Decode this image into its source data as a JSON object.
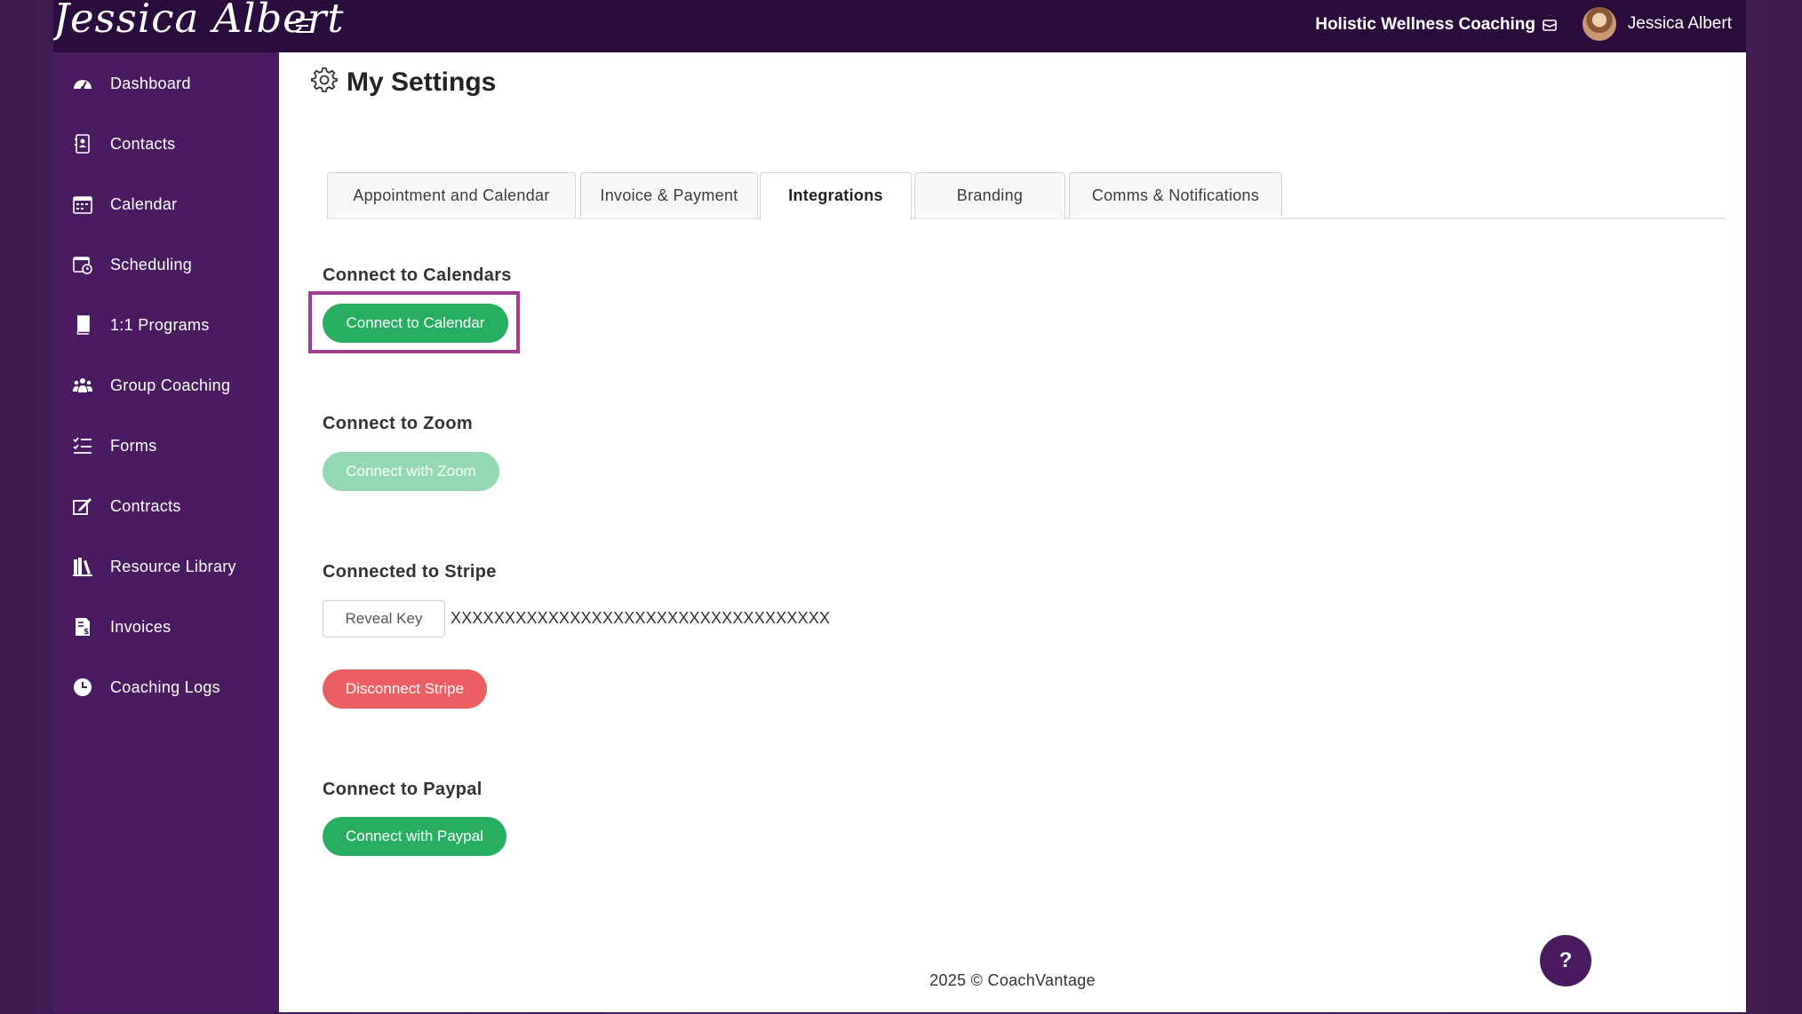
{
  "header": {
    "logo_text": "Jessica Albert",
    "org_name": "Holistic Wellness Coaching",
    "user_name": "Jessica Albert"
  },
  "sidebar": {
    "items": [
      {
        "label": "Dashboard",
        "icon": "dashboard-icon"
      },
      {
        "label": "Contacts",
        "icon": "contacts-icon"
      },
      {
        "label": "Calendar",
        "icon": "calendar-icon"
      },
      {
        "label": "Scheduling",
        "icon": "scheduling-icon"
      },
      {
        "label": "1:1 Programs",
        "icon": "book-icon"
      },
      {
        "label": "Group Coaching",
        "icon": "group-icon"
      },
      {
        "label": "Forms",
        "icon": "forms-icon"
      },
      {
        "label": "Contracts",
        "icon": "signature-icon"
      },
      {
        "label": "Resource Library",
        "icon": "library-icon"
      },
      {
        "label": "Invoices",
        "icon": "invoice-icon"
      },
      {
        "label": "Coaching Logs",
        "icon": "clock-icon"
      }
    ]
  },
  "page": {
    "title": "My Settings"
  },
  "tabs": [
    {
      "label": "Appointment and Calendar"
    },
    {
      "label": "Invoice & Payment"
    },
    {
      "label": "Integrations",
      "active": true
    },
    {
      "label": "Branding"
    },
    {
      "label": "Comms & Notifications"
    }
  ],
  "integrations": {
    "calendars": {
      "title": "Connect to Calendars",
      "button": "Connect to Calendar"
    },
    "zoom": {
      "title": "Connect to Zoom",
      "button": "Connect with Zoom"
    },
    "stripe": {
      "title": "Connected to Stripe",
      "reveal_button": "Reveal Key",
      "masked_key": "XXXXXXXXXXXXXXXXXXXXXXXXXXXXXXXXXXX",
      "disconnect_button": "Disconnect Stripe"
    },
    "paypal": {
      "title": "Connect to Paypal",
      "button": "Connect with Paypal"
    }
  },
  "footer": {
    "text": "2025 © CoachVantage"
  },
  "help": {
    "label": "?"
  },
  "colors": {
    "topbar": "#2a0d3c",
    "sidebar": "#4a1b60",
    "green": "#27ae60",
    "red": "#ec5f62",
    "highlight": "#a23d8f"
  }
}
